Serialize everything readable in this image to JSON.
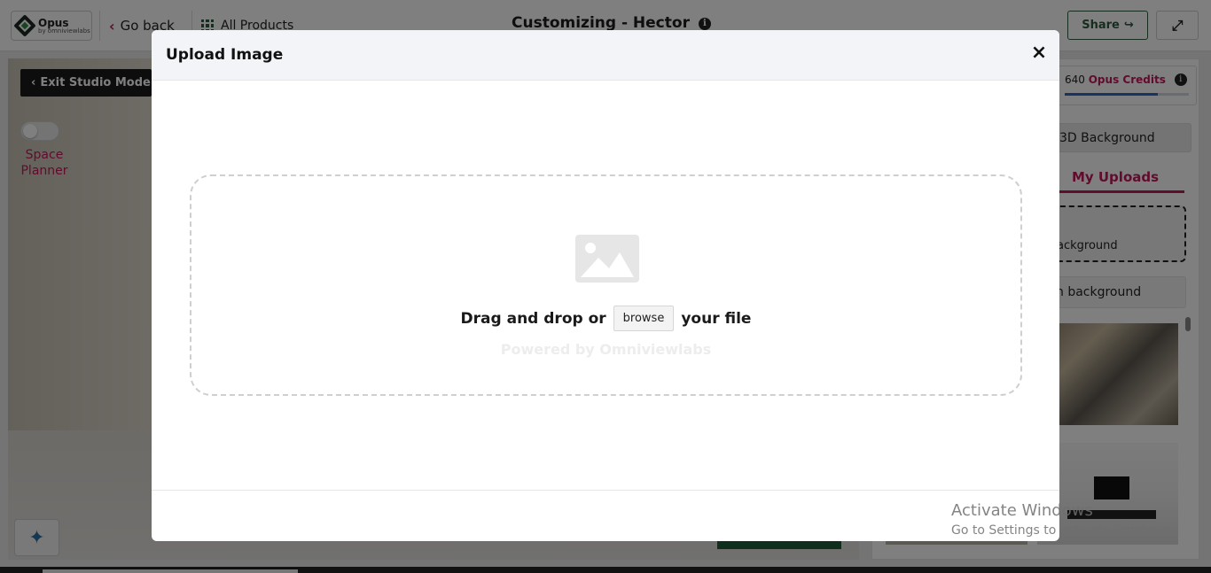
{
  "header": {
    "logo_title": "Opus",
    "logo_sub": "by omniviewlabs",
    "go_back": "Go back",
    "all_products": "All Products",
    "page_title": "Customizing - Hector",
    "share": "Share"
  },
  "studio": {
    "exit_label": "Exit Studio Mode",
    "space_planner_line1": "Space",
    "space_planner_line2": "Planner"
  },
  "right_panel": {
    "credits_value": "640",
    "credits_label": "Opus Credits",
    "credits_fraction": 0.75,
    "tab_3d": "3D Background",
    "tab_uploads": "My Uploads",
    "upload_box_text": "ackground",
    "bg_option_text": "n background"
  },
  "modal": {
    "title": "Upload Image",
    "close": "×",
    "drop_text_before": "Drag and drop or",
    "browse_label": "browse",
    "drop_text_after": "your file",
    "powered_by": "Powered by Omniviewlabs"
  },
  "watermark": {
    "title": "Activate Windows",
    "subtitle": "Go to Settings to activate Windows."
  },
  "colors": {
    "accent": "#c2185b",
    "brand_green": "#2d5a3f",
    "overlay": "rgba(0,0,0,0.5)"
  }
}
